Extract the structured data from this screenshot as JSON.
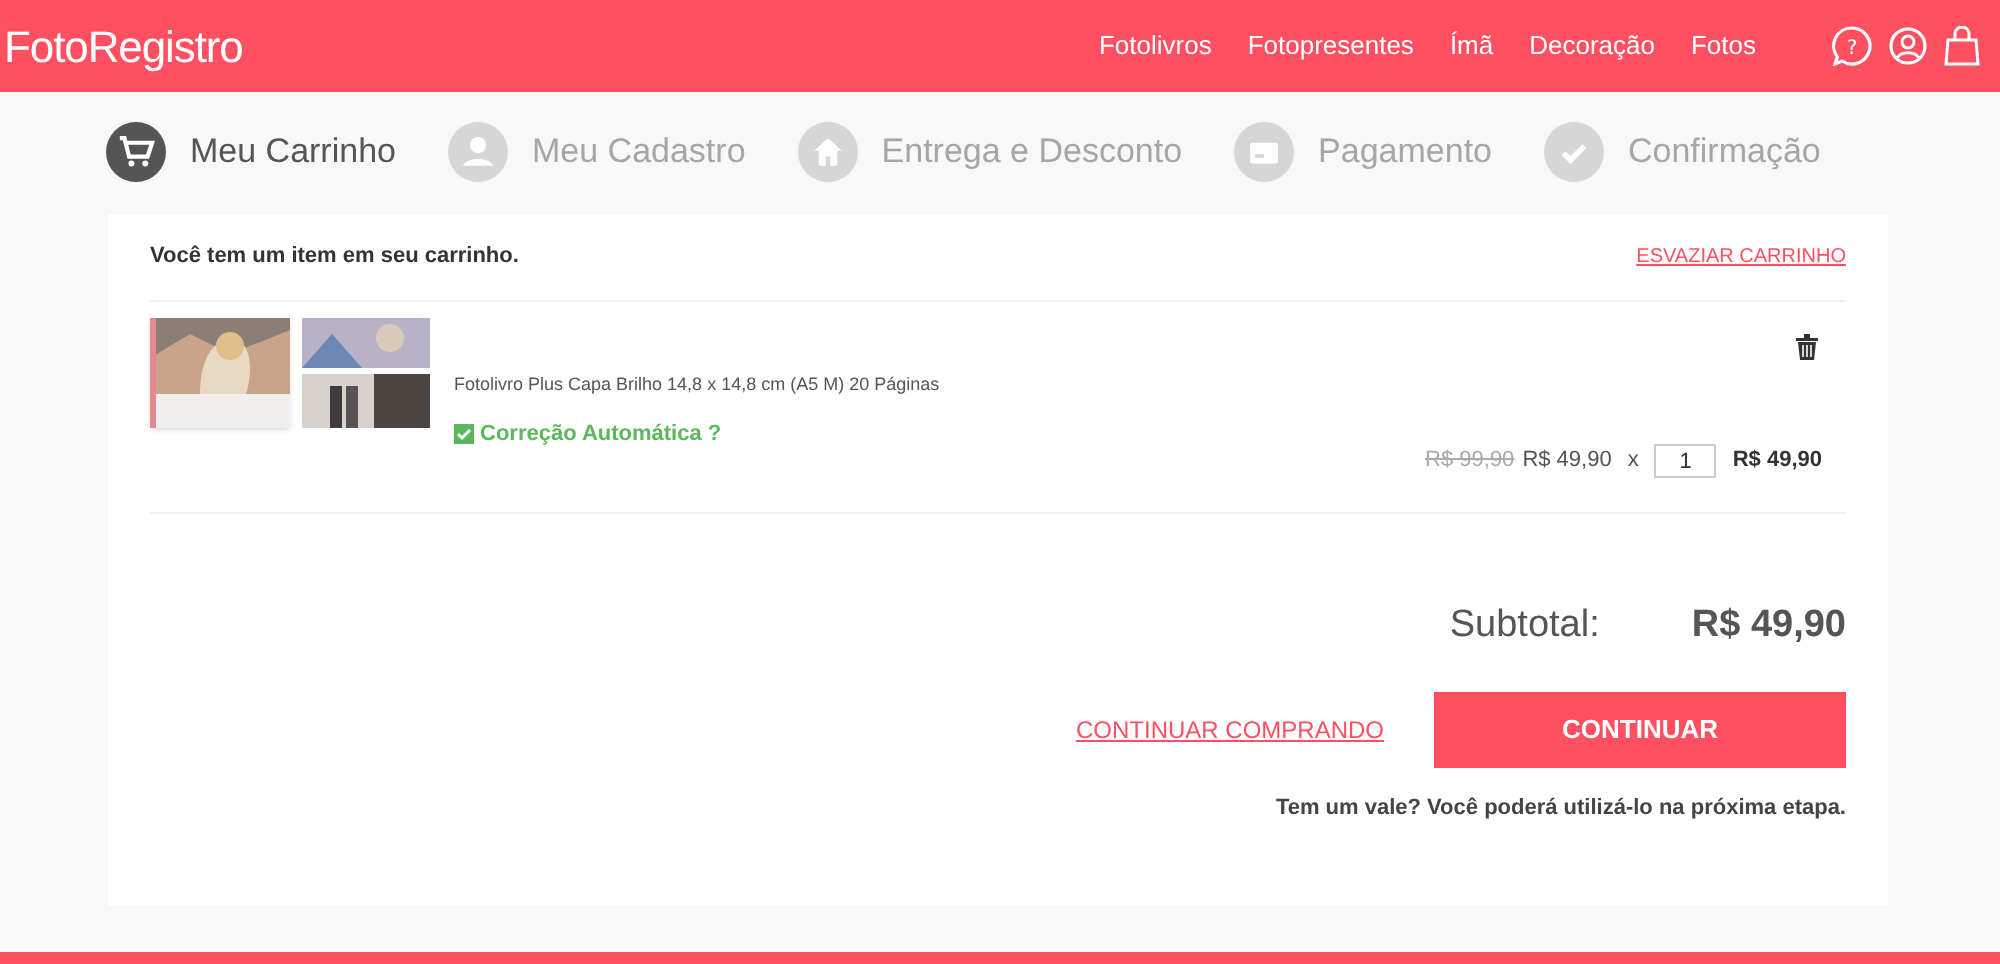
{
  "header": {
    "logo": "FotoRegistro",
    "nav": [
      "Fotolivros",
      "Fotopresentes",
      "Ímã",
      "Decoração",
      "Fotos"
    ],
    "help_glyph": "?"
  },
  "steps": [
    {
      "label": "Meu Carrinho",
      "kind": "cart",
      "selected": true
    },
    {
      "label": "Meu Cadastro",
      "kind": "user",
      "selected": false
    },
    {
      "label": "Entrega e Desconto",
      "kind": "home",
      "selected": false
    },
    {
      "label": "Pagamento",
      "kind": "card",
      "selected": false
    },
    {
      "label": "Confirmação",
      "kind": "check",
      "selected": false
    }
  ],
  "cart": {
    "message": "Você tem um item em seu carrinho.",
    "empty_link": "ESVAZIAR CARRINHO",
    "items": [
      {
        "description": "Fotolivro Plus Capa Brilho 14,8 x 14,8 cm (A5 M) 20 Páginas",
        "auto_correction": {
          "label": "Correção Automática ?",
          "checked": true
        },
        "old_price": "R$ 99,90",
        "price": "R$ 49,90",
        "times": "x",
        "quantity": "1",
        "total": "R$ 49,90"
      }
    ]
  },
  "summary": {
    "label": "Subtotal:",
    "value": "R$ 49,90",
    "continue_shopping": "CONTINUAR COMPRANDO",
    "continue": "CONTINUAR",
    "voucher_note": "Tem um vale? Você poderá utilizá-lo na próxima etapa."
  }
}
